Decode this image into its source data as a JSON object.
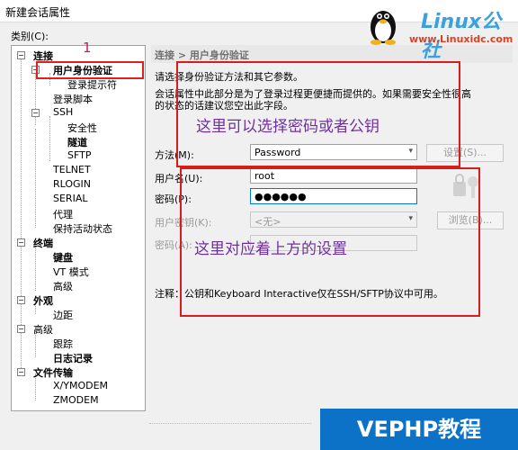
{
  "window": {
    "title": "新建会话属性"
  },
  "category_label": "类别(C):",
  "annotation_number": "1",
  "tree": {
    "items": [
      {
        "label": "连接",
        "bold": true
      },
      {
        "label": "用户身份验证",
        "bold": true,
        "selected": true
      },
      {
        "label": "登录提示符",
        "bold": false
      },
      {
        "label": "登录脚本",
        "bold": false
      },
      {
        "label": "SSH",
        "bold": false
      },
      {
        "label": "安全性",
        "bold": false
      },
      {
        "label": "隧道",
        "bold": true
      },
      {
        "label": "SFTP",
        "bold": false
      },
      {
        "label": "TELNET",
        "bold": false
      },
      {
        "label": "RLOGIN",
        "bold": false
      },
      {
        "label": "SERIAL",
        "bold": false
      },
      {
        "label": "代理",
        "bold": false
      },
      {
        "label": "保持活动状态",
        "bold": false
      },
      {
        "label": "终端",
        "bold": true
      },
      {
        "label": "键盘",
        "bold": true
      },
      {
        "label": "VT 模式",
        "bold": false
      },
      {
        "label": "高级",
        "bold": false
      },
      {
        "label": "外观",
        "bold": true
      },
      {
        "label": "边距",
        "bold": false
      },
      {
        "label": "高级",
        "bold": false
      },
      {
        "label": "跟踪",
        "bold": false
      },
      {
        "label": "日志记录",
        "bold": true
      },
      {
        "label": "文件传输",
        "bold": true
      },
      {
        "label": "X/YMODEM",
        "bold": false
      },
      {
        "label": "ZMODEM",
        "bold": false
      }
    ]
  },
  "panel": {
    "breadcrumb": "连接 > 用户身份验证",
    "desc1": "请选择身份验证方法和其它参数。",
    "desc2": "会话属性中此部分是为了登录过程更便捷而提供的。如果需要安全性很高",
    "desc3": "的状态的话建议您空出此字段。",
    "method_label": "方法(M):",
    "method_value": "Password",
    "setup_button": "设置(S)...",
    "username_label": "用户名(U):",
    "username_value": "root",
    "password_label": "密码(P):",
    "password_value": "●●●●●●",
    "userkey_label": "用户密钥(K):",
    "userkey_value": "<无>",
    "browse_button": "浏览(B)...",
    "passphrase_label": "密码(A):",
    "note": "注释：公钥和Keyboard Interactive仅在SSH/SFTP协议中可用。"
  },
  "annotations": {
    "top": "这里可以选择密码或者公钥",
    "bottom": "这里对应着上方的设置"
  },
  "watermarks": {
    "linux_logo": "Linux公社",
    "linux_url": "www.Linuxidc.com",
    "bottom": "VEPHP教程"
  },
  "colors": {
    "annotation_red": "#d81c1c",
    "annotation_text": "#7030a0",
    "focus_blue": "#0078d7"
  }
}
